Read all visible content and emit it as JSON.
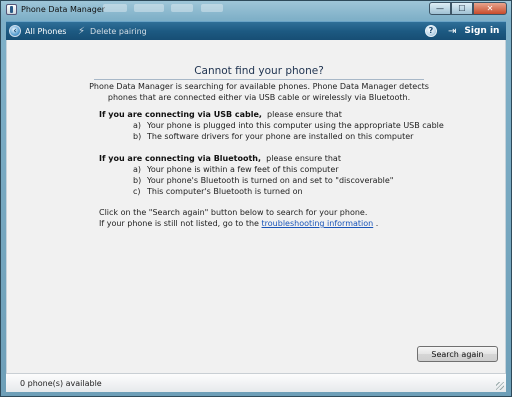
{
  "window": {
    "title": "Phone Data Manager",
    "icon": "phone-app-icon",
    "controls": {
      "minimize": "—",
      "maximize": "☐",
      "close": "✕"
    }
  },
  "toolbar": {
    "all_phones": "All Phones",
    "delete_pairing": "Delete pairing",
    "help_symbol": "?",
    "sign_in": "Sign in",
    "icons": {
      "back": "back-arrow-icon",
      "unpair": "unpair-icon",
      "help": "help-icon",
      "signin": "sign-in-icon"
    }
  },
  "content": {
    "heading": "Cannot find your phone?",
    "intro": "Phone Data Manager is searching for available phones. Phone Data Manager detects phones that are connected either via USB cable or wirelessly via Bluetooth.",
    "usb": {
      "title": "If you are connecting via USB cable,",
      "suffix": "please ensure that",
      "items": [
        {
          "marker": "a)",
          "text": "Your phone is plugged into this computer using the appropriate USB cable"
        },
        {
          "marker": "b)",
          "text": "The software drivers for your phone are installed on this computer"
        }
      ]
    },
    "bluetooth": {
      "title": "If you are connecting via Bluetooth,",
      "suffix": "please ensure that",
      "items": [
        {
          "marker": "a)",
          "text": "Your phone is within a few feet of this computer"
        },
        {
          "marker": "b)",
          "text": "Your phone's Bluetooth is turned on and set to \"discoverable\""
        },
        {
          "marker": "c)",
          "text": "This computer's Bluetooth is turned on"
        }
      ]
    },
    "search_hint": "Click on the \"Search again\" button below to search for your phone.",
    "still_not_listed_prefix": "If your phone is still not listed, go to the",
    "troubleshooting_link": "troubleshooting information",
    "still_not_listed_suffix": ".",
    "search_again_button": "Search again"
  },
  "status": {
    "phones_available": "0 phone(s) available"
  },
  "colors": {
    "toolbar": "#1d5a82",
    "content_bg": "#f1f1f1",
    "link": "#1a55b8",
    "heading": "#1f3350"
  }
}
